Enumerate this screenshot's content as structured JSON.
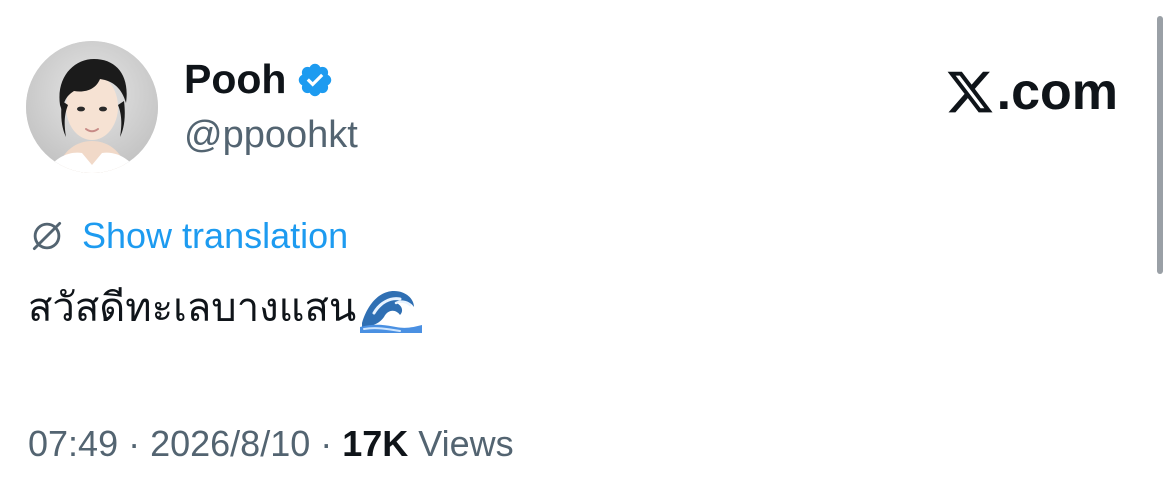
{
  "author": {
    "display_name": "Pooh",
    "handle": "@ppoohkt",
    "avatar_icon": "profile-photo",
    "verified_icon": "verified-badge-icon",
    "verified_color": "#1d9bf0"
  },
  "brand": {
    "logo_icon": "x-logo-icon",
    "text": ".com"
  },
  "translation": {
    "icon": "translate-globe-icon",
    "label": "Show translation",
    "color": "#1d9bf0"
  },
  "tweet": {
    "text": "สวัสดีทะเลบางแสน",
    "emoji_icon": "water-wave-emoji"
  },
  "meta": {
    "time": "07:49",
    "separator": "·",
    "date": "2026/8/10",
    "views_count": "17K",
    "views_label": "Views"
  },
  "colors": {
    "primary_text": "#0f1419",
    "secondary_text": "#536471",
    "accent": "#1d9bf0",
    "background": "#ffffff"
  }
}
